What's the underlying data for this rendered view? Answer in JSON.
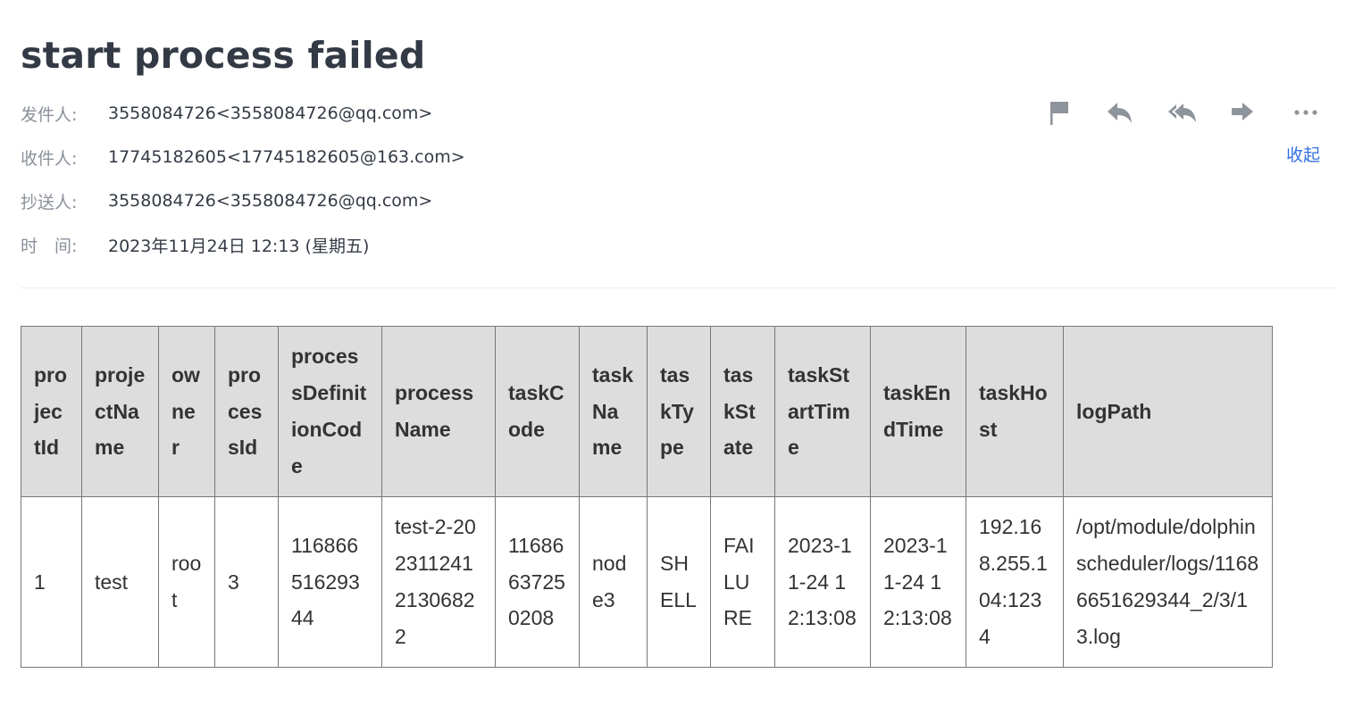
{
  "email": {
    "subject": "start process failed",
    "from_label": "发件人:",
    "from_value": "3558084726<3558084726@qq.com>",
    "to_label": "收件人:",
    "to_value": "17745182605<17745182605@163.com>",
    "cc_label": "抄送人:",
    "cc_value": "3558084726<3558084726@qq.com>",
    "time_label": "时　间:",
    "time_value": "2023年11月24日 12:13 (星期五)",
    "collapse_label": "收起"
  },
  "actions": [
    {
      "name": "flag",
      "icon": "flag-icon"
    },
    {
      "name": "reply",
      "icon": "reply-icon"
    },
    {
      "name": "reply-all",
      "icon": "reply-all-icon"
    },
    {
      "name": "forward",
      "icon": "forward-icon"
    },
    {
      "name": "more",
      "icon": "more-icon"
    }
  ],
  "colors": {
    "text": "#333a45",
    "label": "#8a909a",
    "link": "#3370e0",
    "icon": "#8e949c",
    "table_header_bg": "#dddddd",
    "table_border": "#777777"
  },
  "table": {
    "headers": [
      "projectId",
      "projectName",
      "owner",
      "processId",
      "processDefinitionCode",
      "processName",
      "taskCode",
      "taskName",
      "taskType",
      "taskState",
      "taskStartTime",
      "taskEndTime",
      "taskHost",
      "logPath"
    ],
    "rows": [
      [
        "1",
        "test",
        "root",
        "3",
        "11686651629344",
        "test-2-20231124121306822",
        "11686637250208",
        "node3",
        "SHELL",
        "FAILURE",
        "2023-11-24 12:13:08",
        "2023-11-24 12:13:08",
        "192.168.255.104:1234",
        "/opt/module/dolphinscheduler/logs/11686651629344_2/3/13.log"
      ]
    ]
  }
}
